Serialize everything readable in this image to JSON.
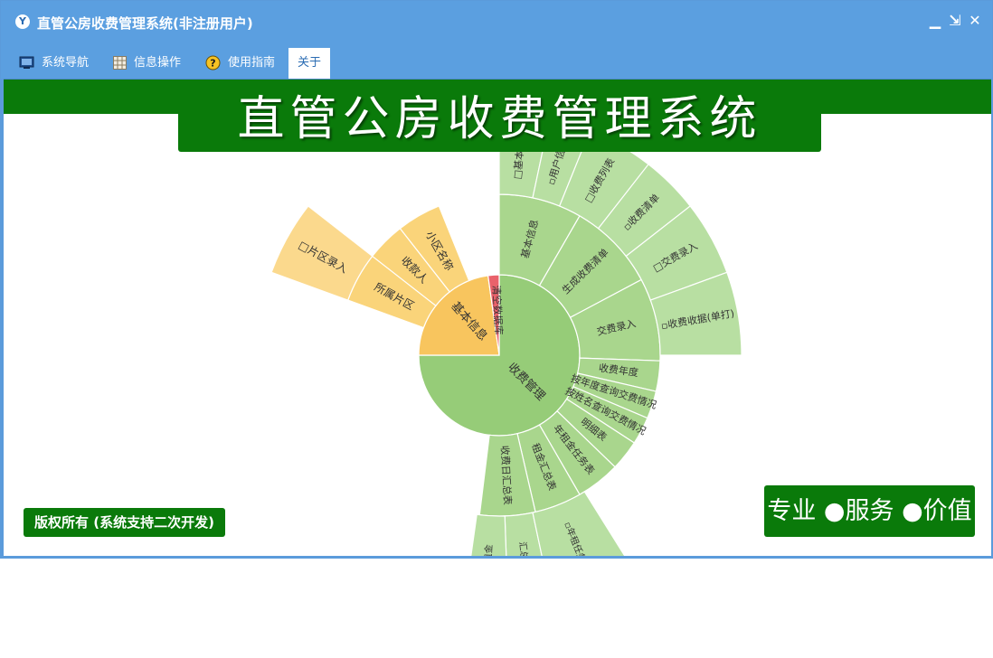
{
  "window": {
    "title": "直管公房收费管理系统(非注册用户)",
    "minimize_glyph": "▁",
    "restore_glyph": "⇲",
    "close_glyph": "✕"
  },
  "menu": {
    "items": [
      {
        "label": "系统导航",
        "icon": "monitor-icon"
      },
      {
        "label": "信息操作",
        "icon": "grid-icon"
      },
      {
        "label": "使用指南",
        "icon": "help-icon"
      },
      {
        "label": "关于",
        "icon": ""
      }
    ]
  },
  "content": {
    "banner_title": "直管公房收费管理系统",
    "copyright": "版权所有 (系统支持二次开发)",
    "slogan": "专业 ●服务 ●价值",
    "colors": {
      "band": "#0a7a0a",
      "green_inner": "#96cc78",
      "green_mid": "#a9d68d",
      "green_outer": "#b8dfa2",
      "orange_inner": "#f8c55e",
      "orange_mid": "#fad47a",
      "orange_outer": "#fbd98d",
      "red": "#e9626b"
    }
  },
  "chart_data": {
    "type": "sunburst",
    "root": {
      "label": "收费管理",
      "children": [
        {
          "label": "清空数据库",
          "children": []
        },
        {
          "label": "基本信息",
          "children": [
            {
              "label": "所属片区",
              "children": [
                {
                  "label": "□片区录入"
                }
              ]
            },
            {
              "label": "收款人",
              "children": []
            },
            {
              "label": "小区名称",
              "children": []
            }
          ]
        }
      ]
    },
    "ring1": [
      "收费管理",
      "基本信息",
      "清空数据库"
    ],
    "ring2": [
      "基本信息",
      "生成收费清单",
      "交费录入",
      "收费年度",
      "按年度查询交费情况",
      "按姓名查询交费情况",
      "明细表",
      "年租金任务表",
      "租金汇总表",
      "收费日汇总表",
      "所属片区",
      "收款人",
      "小区名称"
    ],
    "ring3": [
      "□基本信息",
      "▫用户信息",
      "□收费列表",
      "▫收费清单",
      "□交费录入",
      "▫收费收据(单打)",
      "□片区录入",
      "汇总表",
      "▫租金",
      "▫年租任务"
    ]
  }
}
